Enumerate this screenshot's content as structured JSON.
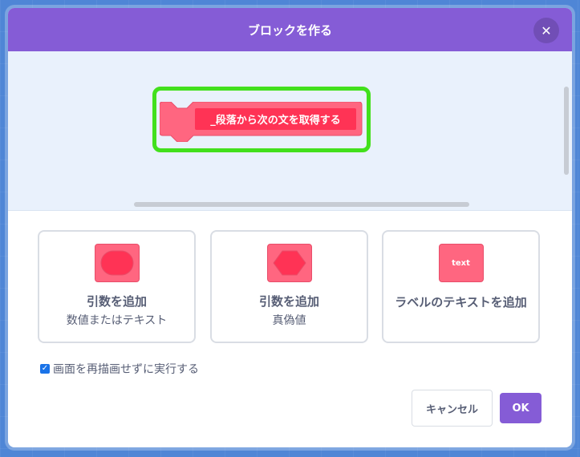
{
  "dialog": {
    "title": "ブロックを作る",
    "close_icon": "close-icon"
  },
  "block_preview": {
    "label": "_段落から次の文を取得する",
    "color": "#ff6680"
  },
  "options": [
    {
      "title": "引数を追加",
      "subtitle": "数値またはテキスト",
      "icon": "round-input-icon"
    },
    {
      "title": "引数を追加",
      "subtitle": "真偽値",
      "icon": "boolean-input-icon"
    },
    {
      "title": "ラベルのテキストを追加",
      "icon_text": "text",
      "icon": "text-label-icon"
    }
  ],
  "run_without_refresh": {
    "label": "画面を再描画せずに実行する",
    "checked": true
  },
  "buttons": {
    "cancel": "キャンセル",
    "ok": "OK"
  },
  "colors": {
    "header": "#855cd6",
    "highlight": "#42e01c",
    "block": "#ff6680"
  }
}
